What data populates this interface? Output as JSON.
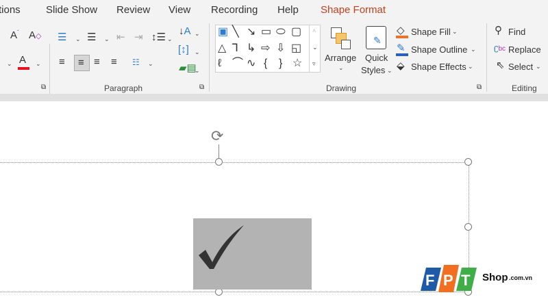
{
  "tabs": [
    {
      "label": "tions"
    },
    {
      "label": "Slide Show"
    },
    {
      "label": "Review"
    },
    {
      "label": "View"
    },
    {
      "label": "Recording"
    },
    {
      "label": "Help"
    },
    {
      "label": "Shape Format",
      "active": true
    }
  ],
  "groups": {
    "paragraph": "Paragraph",
    "drawing": "Drawing",
    "editing": "Editing"
  },
  "drawing": {
    "arrange": "Arrange",
    "quick_styles_1": "Quick",
    "quick_styles_2": "Styles",
    "shape_fill": "Shape Fill",
    "shape_outline": "Shape Outline",
    "shape_effects": "Shape Effects"
  },
  "editing": {
    "find": "Find",
    "replace": "Replace",
    "select": "Select"
  },
  "logo": {
    "text": "FPT",
    "shop": "Shop",
    "domain": ".com.vn"
  },
  "colors": {
    "accent": "#c43e1c",
    "font_color": "#e81123",
    "shape_fill": "#b3b3b3"
  }
}
